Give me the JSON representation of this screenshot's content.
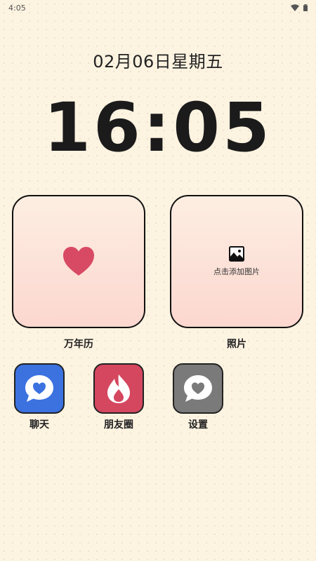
{
  "status_bar": {
    "time": "4:05",
    "icons": [
      "wifi-icon",
      "battery-icon"
    ]
  },
  "lock": {
    "date": "02月06日星期五",
    "time": "16:05"
  },
  "widgets": [
    {
      "id": "calendar",
      "label": "万年历",
      "icon": "heart-icon"
    },
    {
      "id": "photo",
      "label": "照片",
      "icon": "image-icon",
      "hint": "点击添加图片"
    }
  ],
  "apps": [
    {
      "id": "chat",
      "label": "聊天",
      "icon": "chat-heart-icon",
      "color": "#3b72e0"
    },
    {
      "id": "moments",
      "label": "朋友圈",
      "icon": "flame-icon",
      "color": "#d4475f"
    },
    {
      "id": "settings",
      "label": "设置",
      "icon": "chat-heart-icon",
      "color": "#7a7a7a"
    }
  ],
  "colors": {
    "background": "#fdf3e1",
    "heart": "#d84a63",
    "widget_gradient_top": "#fdeee2",
    "widget_gradient_bottom": "#fcd7cf"
  }
}
